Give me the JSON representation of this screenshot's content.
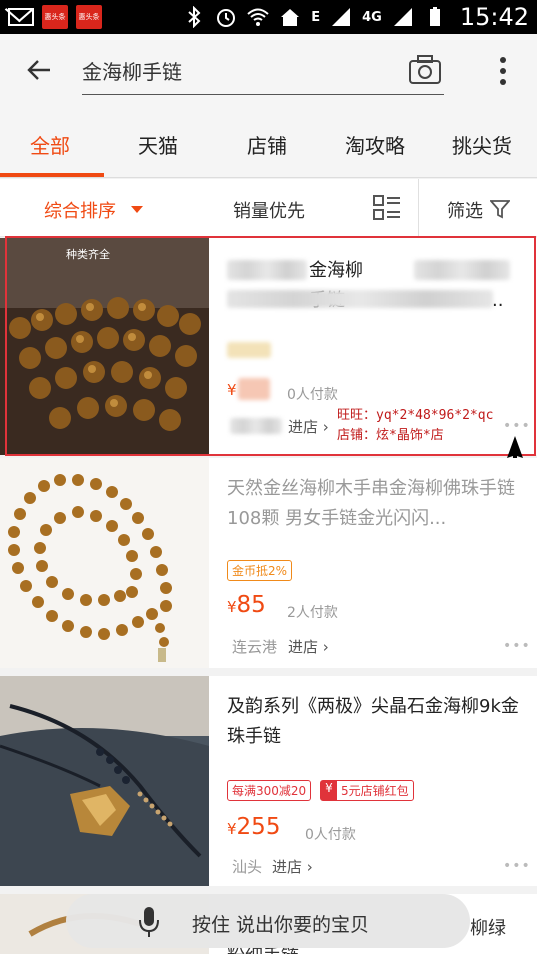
{
  "status_bar": {
    "app_icon_1": "惠头条",
    "app_icon_2": "惠头条",
    "network": "4G",
    "network_e": "E",
    "time": "15:42"
  },
  "search": {
    "query": "金海柳手链"
  },
  "tabs": [
    "全部",
    "天猫",
    "店铺",
    "淘攻略",
    "挑尖货"
  ],
  "sort": {
    "main": "综合排序",
    "sales": "销量优先",
    "filter": "筛选"
  },
  "items": [
    {
      "thumb_text": "种类齐全",
      "title_visible": "金海柳手链",
      "title_ellipsis": "..",
      "price_symbol": "¥",
      "paid": "0人付款",
      "enter": "进店",
      "annotation_line1": "旺旺：yq*2*48*96*2*qc",
      "annotation_line2": "店铺：炫*晶饰*店"
    },
    {
      "title": "天然金丝海柳木手串金海柳佛珠手链108颗 男女手链金光闪闪...",
      "badge": "金币抵2%",
      "price_symbol": "¥",
      "price": "85",
      "paid": "2人付款",
      "location": "连云港",
      "enter": "进店"
    },
    {
      "title": "及韵系列《两极》尖晶石金海柳9k金珠手链",
      "badge1": "每满300减20",
      "badge2_icon": "¥",
      "badge2": "5元店铺红包",
      "price_symbol": "¥",
      "price": "255",
      "paid": "0人付款",
      "location": "汕头",
      "enter": "进店"
    },
    {
      "title_partial_right": "柳绿",
      "title_partial_bottom": "粉细手链"
    }
  ],
  "voice": {
    "label": "按住 说出你要的宝贝"
  },
  "colors": {
    "accent": "#f04a13",
    "annotation": "#c01a1a",
    "highlight_border": "#e0333a"
  }
}
